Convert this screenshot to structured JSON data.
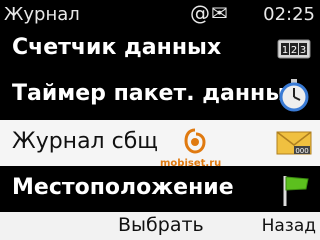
{
  "status": {
    "title": "Журнал",
    "icons": "@✉",
    "time": "02:25"
  },
  "menu": {
    "items": [
      {
        "label": "Счетчик данных",
        "icon": "counter-123-icon"
      },
      {
        "label": "Таймер пакет. данных",
        "icon": "stopwatch-icon"
      },
      {
        "label": "Журнал сбщ",
        "icon": "envelope-icon",
        "selected": true
      },
      {
        "label": "Местоположение",
        "icon": "flag-icon"
      }
    ]
  },
  "watermark": "mobiset.ru",
  "softkeys": {
    "center": "Выбрать",
    "right": "Назад"
  },
  "colors": {
    "background": "#000000",
    "selection": "#f5f5f5",
    "flag": "#5cc01e",
    "envelope": "#e8b830",
    "watermark": "#e07a10"
  }
}
